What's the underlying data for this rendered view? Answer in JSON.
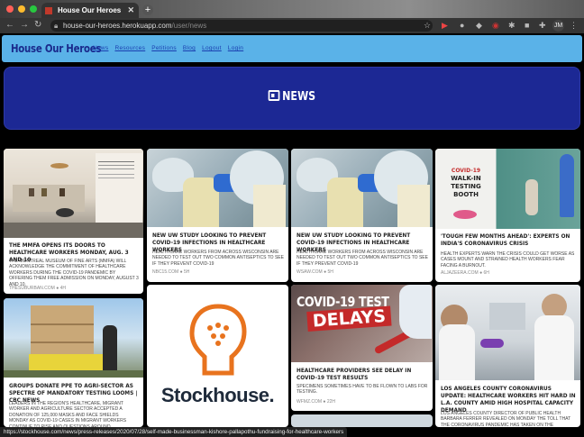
{
  "browser": {
    "tab_title": "House Our Heroes",
    "url_host": "house-our-heroes.herokuapp.com",
    "url_path": "/user/news",
    "profile_initials": "JM",
    "status_url": "https://stockhouse.com/news/press-releases/2020/07/28/self-made-businessman-kishore-pallapothu-fundraising-for-healthcare-workers"
  },
  "site": {
    "brand": "House Our Heroes",
    "nav_links": [
      "News",
      "Resources",
      "Petitions",
      "Blog",
      "Logout",
      "Login"
    ],
    "banner_title": "NEWS"
  },
  "articles": [
    {
      "title": "The MMFA opens its doors to healthcare workers Monday, Aug. 3 and 10",
      "description": "The Montreal Museum of Fine Arts (MMFA) will acknowledge the commitment of healthcare workers during the COVID-19 pandemic by offering them free admission on Monday, August 3 and 10.",
      "source": "THESUBURBAN.COM",
      "age": "4H"
    },
    {
      "title": "New UW study looking to prevent COVID-19 infections in healthcare workers",
      "description": "Healthcare workers from across Wisconsin are needed to test out two common antiseptics to see if they prevent COVID-19",
      "source": "NBC15.COM",
      "age": "5H"
    },
    {
      "title": "New UW study looking to prevent COVID-19 infections in healthcare workers",
      "description": "Healthcare workers from across Wisconsin are needed to test out two common antiseptics to see if they prevent COVID-19",
      "source": "WSAW.COM",
      "age": "5H"
    },
    {
      "title": "'Tough few months ahead': Experts on India's coronavirus crisis",
      "description": "Health experts warn the crisis could get worse as cases mount and strained health workers fear facing a burnout.",
      "source": "ALJAZEERA.COM",
      "age": "6H"
    },
    {
      "title": "Groups donate PPE to agri-sector as spectre of mandatory testing looms | CBC News",
      "description": "Leaders in the region's healthcare, migrant worker and agriculture sector accepted a donation of 125,000 masks and face shields Monday as COVID-19 cases in migrant workers continue to rise and questions around mandatory testing continue.",
      "source": "",
      "age": ""
    },
    {
      "title": "",
      "description": "",
      "source": "",
      "age": "",
      "logo_text": "Stockhouse."
    },
    {
      "title": "Healthcare providers see delay in COVID-19 test results",
      "description": "Specimens sometimes have to be flown to labs for testing.",
      "source": "WFMZ.COM",
      "age": "22H",
      "image_text_1": "COVID-19 TEST",
      "image_text_2": "DELAYS"
    },
    {
      "title": "Los Angeles County coronavirus update: Healthcare workers hit hard in L.A. County amid high hospital capacity demand",
      "description": "Los Angeles County Director of Public Health Barbara Ferrer revealed on Monday the toll that the coronavirus pandemic has taken on the region's healthcare workers, while it was well",
      "source": "",
      "age": ""
    }
  ],
  "booth_sign": {
    "line1": "COVID-19",
    "line2": "WALK-IN",
    "line3": "TESTING",
    "line4": "BOOTH"
  },
  "colors": {
    "navbar": "#5ab2e8",
    "banner": "#1c2894",
    "brand": "#1a2a8c",
    "covid_red": "#c42a2a",
    "stockhouse_orange": "#e8731e"
  }
}
